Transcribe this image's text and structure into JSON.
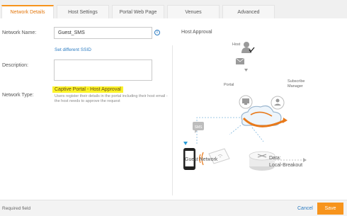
{
  "tabs": [
    {
      "label": "Network Details"
    },
    {
      "label": "Host Settings"
    },
    {
      "label": "Portal Web Page"
    },
    {
      "label": "Venues"
    },
    {
      "label": "Advanced"
    }
  ],
  "form": {
    "network_name_label": "Network Name:",
    "network_name_value": "Guest_SMS",
    "set_ssid_link": "Set different SSID",
    "description_label": "Description:",
    "description_value": "",
    "network_type_label": "Network Type:",
    "network_type_value": "Captive Portal - Host Approval",
    "network_type_desc": "Users register their details in the portal including their host email - the host needs to approve the request"
  },
  "diagram": {
    "title": "Host Approval",
    "host_label": "Host",
    "portal_label": "Portal",
    "subscribe_label": "Subscribe Manager",
    "sms_label": "SMS",
    "guest_network_label": "Guest Network",
    "data_label": "Data:",
    "data_value": "Local-Breakout"
  },
  "footer": {
    "required_label": "Required field",
    "cancel_label": "Cancel",
    "save_label": "Save"
  },
  "colors": {
    "accent": "#f7941d",
    "link": "#2a7ac1",
    "highlight": "#fbf32a"
  }
}
